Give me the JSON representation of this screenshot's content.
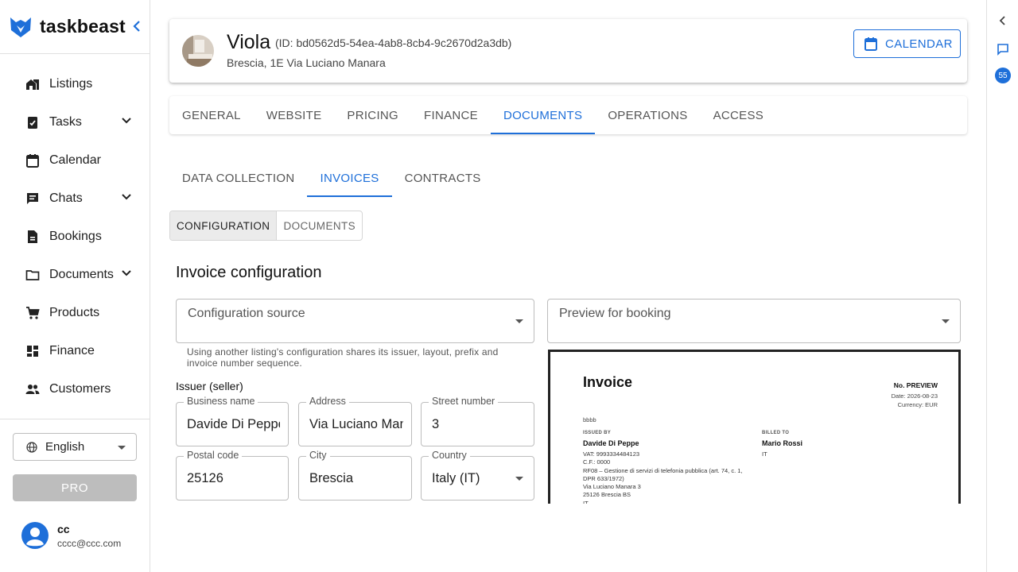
{
  "app": {
    "name": "taskbeast"
  },
  "sidebar": {
    "items": [
      {
        "label": "Listings",
        "icon": "listings-icon",
        "expandable": false
      },
      {
        "label": "Tasks",
        "icon": "tasks-icon",
        "expandable": true
      },
      {
        "label": "Calendar",
        "icon": "calendar-icon",
        "expandable": false
      },
      {
        "label": "Chats",
        "icon": "chats-icon",
        "expandable": true
      },
      {
        "label": "Bookings",
        "icon": "bookings-icon",
        "expandable": false
      },
      {
        "label": "Documents",
        "icon": "folder-icon",
        "expandable": true
      },
      {
        "label": "Products",
        "icon": "cart-icon",
        "expandable": false
      },
      {
        "label": "Finance",
        "icon": "dashboard-icon",
        "expandable": false
      },
      {
        "label": "Customers",
        "icon": "people-icon",
        "expandable": false
      }
    ],
    "language": "English",
    "pro_label": "PRO",
    "user": {
      "name": "cc",
      "email": "cccc@ccc.com"
    }
  },
  "rail": {
    "badge_count": "55"
  },
  "header": {
    "name": "Viola",
    "id_text": "(ID: bd0562d5-54ea-4ab8-8cb4-9c2670d2a3db)",
    "address": "Brescia, 1E Via Luciano Manara",
    "calendar_button": "CALENDAR"
  },
  "tabs": [
    "GENERAL",
    "WEBSITE",
    "PRICING",
    "FINANCE",
    "DOCUMENTS",
    "OPERATIONS",
    "ACCESS"
  ],
  "active_tab": "DOCUMENTS",
  "sub_tabs": [
    "DATA COLLECTION",
    "INVOICES",
    "CONTRACTS"
  ],
  "active_sub_tab": "INVOICES",
  "segments": [
    "CONFIGURATION",
    "DOCUMENTS"
  ],
  "active_segment": "CONFIGURATION",
  "section_title": "Invoice configuration",
  "config_source": {
    "label": "Configuration source",
    "helper": "Using another listing's configuration shares its issuer, layout, prefix and invoice number sequence."
  },
  "preview_booking": {
    "label": "Preview for booking"
  },
  "issuer": {
    "heading": "Issuer (seller)",
    "business_name": {
      "label": "Business name",
      "value": "Davide Di Peppe"
    },
    "address": {
      "label": "Address",
      "value": "Via Luciano Manara"
    },
    "street_number": {
      "label": "Street number",
      "value": "3"
    },
    "postal_code": {
      "label": "Postal code",
      "value": "25126"
    },
    "city": {
      "label": "City",
      "value": "Brescia"
    },
    "country": {
      "label": "Country",
      "value": "Italy (IT)"
    }
  },
  "invoice_preview": {
    "title": "Invoice",
    "number": "No. PREVIEW",
    "date": "Date: 2026-08-23",
    "currency": "Currency: EUR",
    "note": "bbbb",
    "issued_by_label": "ISSUED BY",
    "issuer_name": "Davide Di Peppe",
    "billed_to_label": "BILLED TO",
    "billed_name": "Mario Rossi",
    "billed_country": "IT",
    "issuer_lines": [
      "VAT: 9993334484123",
      "C.F.: 0000",
      "RF08 – Gestione di servizi di telefonia pubblica (art. 74, c. 1, DPR 633/1972)",
      "Via Luciano Manara 3",
      "25126 Brescia BS",
      "IT"
    ]
  },
  "colors": {
    "accent": "#1e6fd9",
    "logo": "#1e6fd9",
    "disabled": "#bdbdbd"
  }
}
